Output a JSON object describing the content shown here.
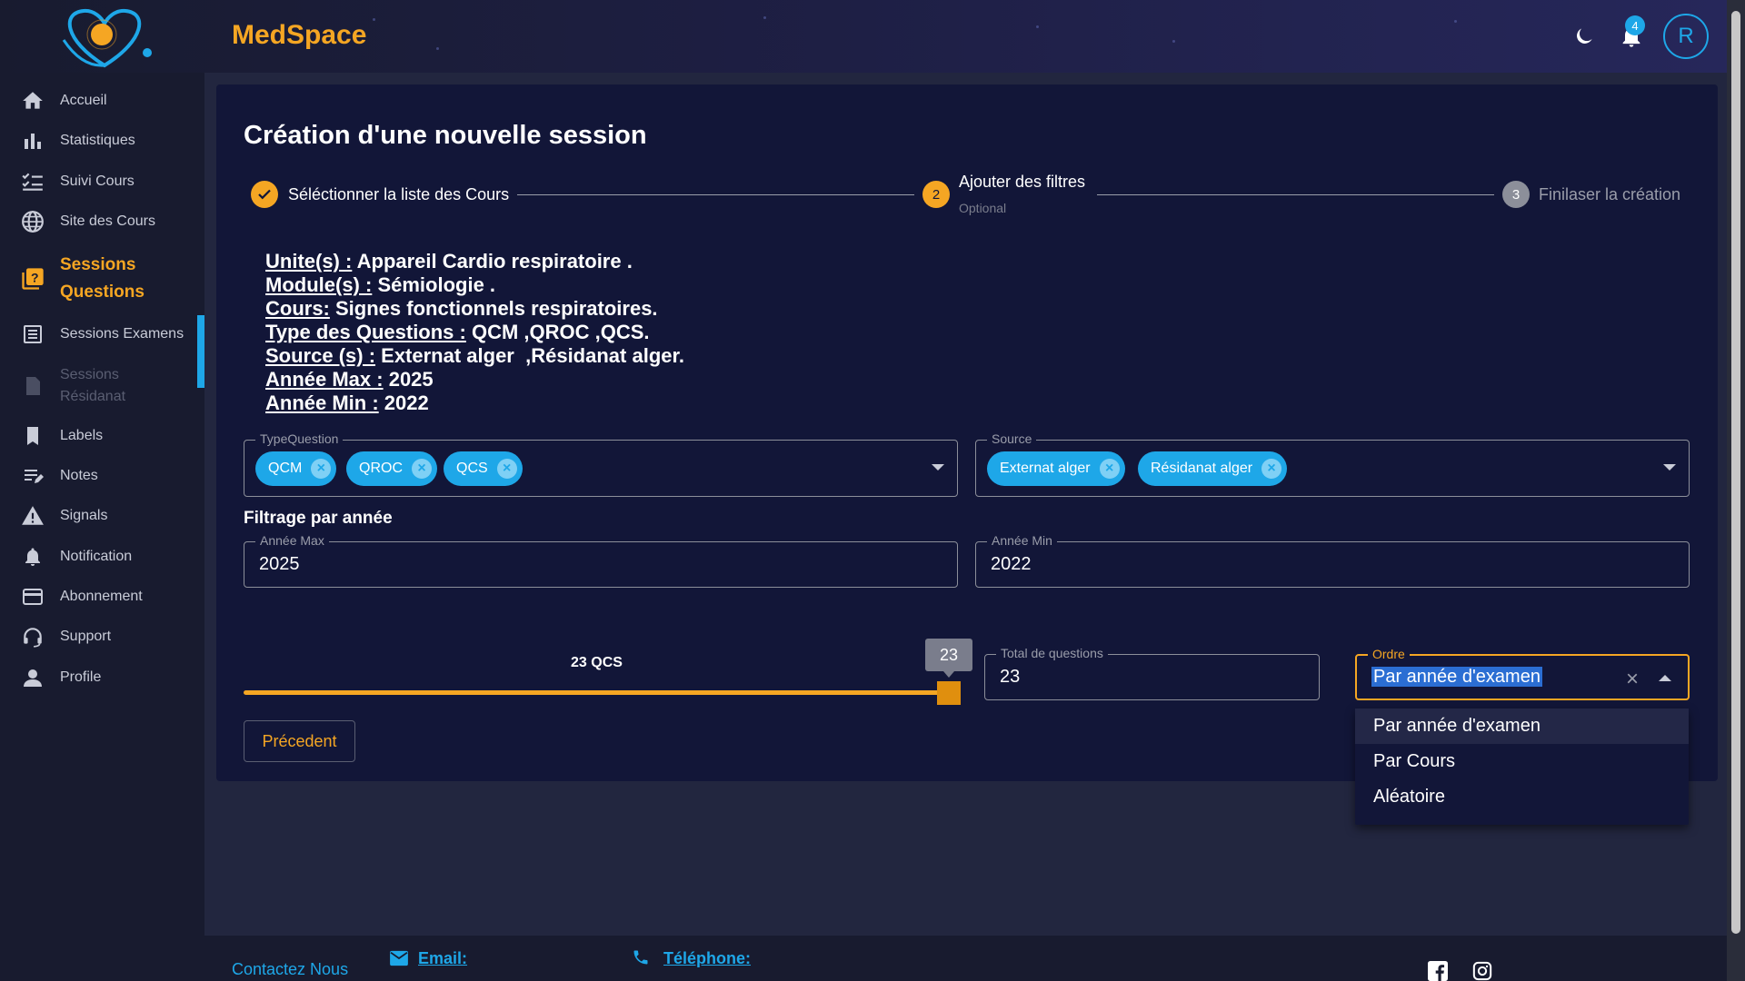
{
  "header": {
    "brand": "MedSpace",
    "notification_count": "4",
    "avatar_initial": "R"
  },
  "sidebar": {
    "items": [
      {
        "label": "Accueil",
        "icon": "home-icon"
      },
      {
        "label": "Statistiques",
        "icon": "bar-chart-icon"
      },
      {
        "label": "Suivi Cours",
        "icon": "checklist-icon"
      },
      {
        "label": "Site des Cours",
        "icon": "globe-icon"
      },
      {
        "label": "Sessions Questions",
        "icon": "quiz-icon"
      },
      {
        "label": "Sessions Examens",
        "icon": "list-icon"
      },
      {
        "label": "Sessions Résidanat",
        "icon": "document-icon"
      },
      {
        "label": "Labels",
        "icon": "bookmark-icon"
      },
      {
        "label": "Notes",
        "icon": "note-edit-icon"
      },
      {
        "label": "Signals",
        "icon": "warning-icon"
      },
      {
        "label": "Notification",
        "icon": "bell-icon"
      },
      {
        "label": "Abonnement",
        "icon": "credit-card-icon"
      },
      {
        "label": "Support",
        "icon": "headset-icon"
      },
      {
        "label": "Profile",
        "icon": "person-icon"
      }
    ]
  },
  "page": {
    "title": "Création d'une nouvelle session"
  },
  "stepper": {
    "step1": "Séléctionner la liste des Cours",
    "step2": "Ajouter des filtres",
    "step2_number": "2",
    "step2_sub": "Optional",
    "step3": "Finilaser la création",
    "step3_number": "3"
  },
  "summary": [
    {
      "key": "Unite(s) :",
      "value": " Appareil Cardio respiratoire ."
    },
    {
      "key": "Module(s) :",
      "value": " Sémiologie ."
    },
    {
      "key": "Cours:",
      "value": " Signes fonctionnels respiratoires."
    },
    {
      "key": "Type des Questions :",
      "value": " QCM ,QROC ,QCS."
    },
    {
      "key": "Source (s) :",
      "value": " Externat alger  ,Résidanat alger."
    },
    {
      "key": "Année Max :",
      "value": " 2025"
    },
    {
      "key": "Année Min :",
      "value": " 2022"
    }
  ],
  "filters": {
    "type_question_label": "TypeQuestion",
    "type_question_chips": [
      "QCM",
      "QROC",
      "QCS"
    ],
    "source_label": "Source",
    "source_chips": [
      "Externat alger",
      "Résidanat alger"
    ],
    "year_section": "Filtrage par année",
    "annee_max_label": "Année Max",
    "annee_max_value": "2025",
    "annee_min_label": "Année Min",
    "annee_min_value": "2022"
  },
  "slider": {
    "value": 23,
    "max_fraction": 1.0,
    "tooltip": "23",
    "label": "23 QCS"
  },
  "total": {
    "label": "Total de questions",
    "value": "23"
  },
  "ordre": {
    "label": "Ordre",
    "value": "Par année d'examen",
    "options": [
      "Par année d'examen",
      "Par Cours",
      "Aléatoire"
    ]
  },
  "buttons": {
    "prev": "Précedent"
  },
  "footer": {
    "contact": "Contactez Nous",
    "email_label": "Email:",
    "phone_label": "Téléphone:"
  },
  "colors": {
    "accent": "#f5a623",
    "primary": "#1ea7e8",
    "background": "#22263f",
    "card": "#121638"
  }
}
